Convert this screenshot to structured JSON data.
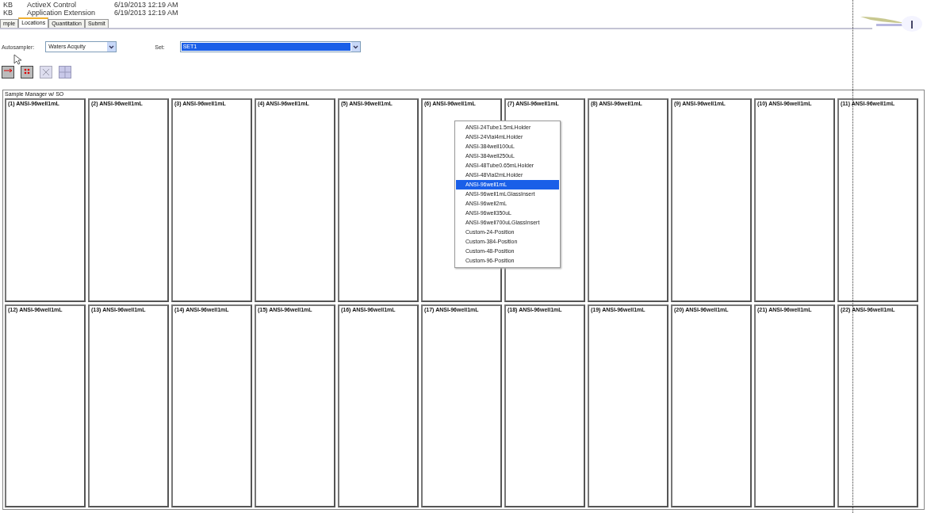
{
  "files": [
    {
      "type": "KB",
      "name": "ActiveX Control",
      "date": "6/19/2013 12:19 AM"
    },
    {
      "type": "KB",
      "name": "Application Extension",
      "date": "6/19/2013 12:19 AM"
    }
  ],
  "tabs": [
    {
      "label": "mple",
      "selected": false
    },
    {
      "label": "Locations",
      "selected": true
    },
    {
      "label": "Quantitation",
      "selected": false
    },
    {
      "label": "Submit",
      "selected": false
    }
  ],
  "autosampler": {
    "label": "Autosampler:",
    "value": "Waters Acquity"
  },
  "set": {
    "label": "Set:",
    "value": "SET1"
  },
  "group": {
    "title": "Sample Manager w/ SO",
    "plates": [
      "(1) ANSI-96well1mL",
      "(2) ANSI-96well1mL",
      "(3) ANSI-96well1mL",
      "(4) ANSI-96well1mL",
      "(5) ANSI-96well1mL",
      "(6) ANSI-96well1mL",
      "(7) ANSI-96well1mL",
      "(8) ANSI-96well1mL",
      "(9) ANSI-96well1mL",
      "(10) ANSI-96well1mL",
      "(11) ANSI-96well1mL",
      "(12) ANSI-96well1mL",
      "(13) ANSI-96well1mL",
      "(14) ANSI-96well1mL",
      "(15) ANSI-96well1mL",
      "(16) ANSI-96well1mL",
      "(17) ANSI-96well1mL",
      "(18) ANSI-96well1mL",
      "(19) ANSI-96well1mL",
      "(20) ANSI-96well1mL",
      "(21) ANSI-96well1mL",
      "(22) ANSI-96well1mL"
    ]
  },
  "plate_menu": [
    {
      "label": "ANSI-24Tube1.5mLHolder",
      "selected": false
    },
    {
      "label": "ANSI-24Vial4mLHolder",
      "selected": false
    },
    {
      "label": "ANSI-384well100uL",
      "selected": false
    },
    {
      "label": "ANSI-384well250uL",
      "selected": false
    },
    {
      "label": "ANSI-48Tube0.65mLHolder",
      "selected": false
    },
    {
      "label": "ANSI-48Vial2mLHolder",
      "selected": false
    },
    {
      "label": "ANSI-96well1mL",
      "selected": true
    },
    {
      "label": "ANSI-96well1mLGlassInsert",
      "selected": false
    },
    {
      "label": "ANSI-96well2mL",
      "selected": false
    },
    {
      "label": "ANSI-96well350uL",
      "selected": false
    },
    {
      "label": "ANSI-96well700uLGlassInsert",
      "selected": false
    },
    {
      "label": "Custom-24-Position",
      "selected": false
    },
    {
      "label": "Custom-384-Position",
      "selected": false
    },
    {
      "label": "Custom-48-Position",
      "selected": false
    },
    {
      "label": "Custom-96-Position",
      "selected": false
    }
  ]
}
